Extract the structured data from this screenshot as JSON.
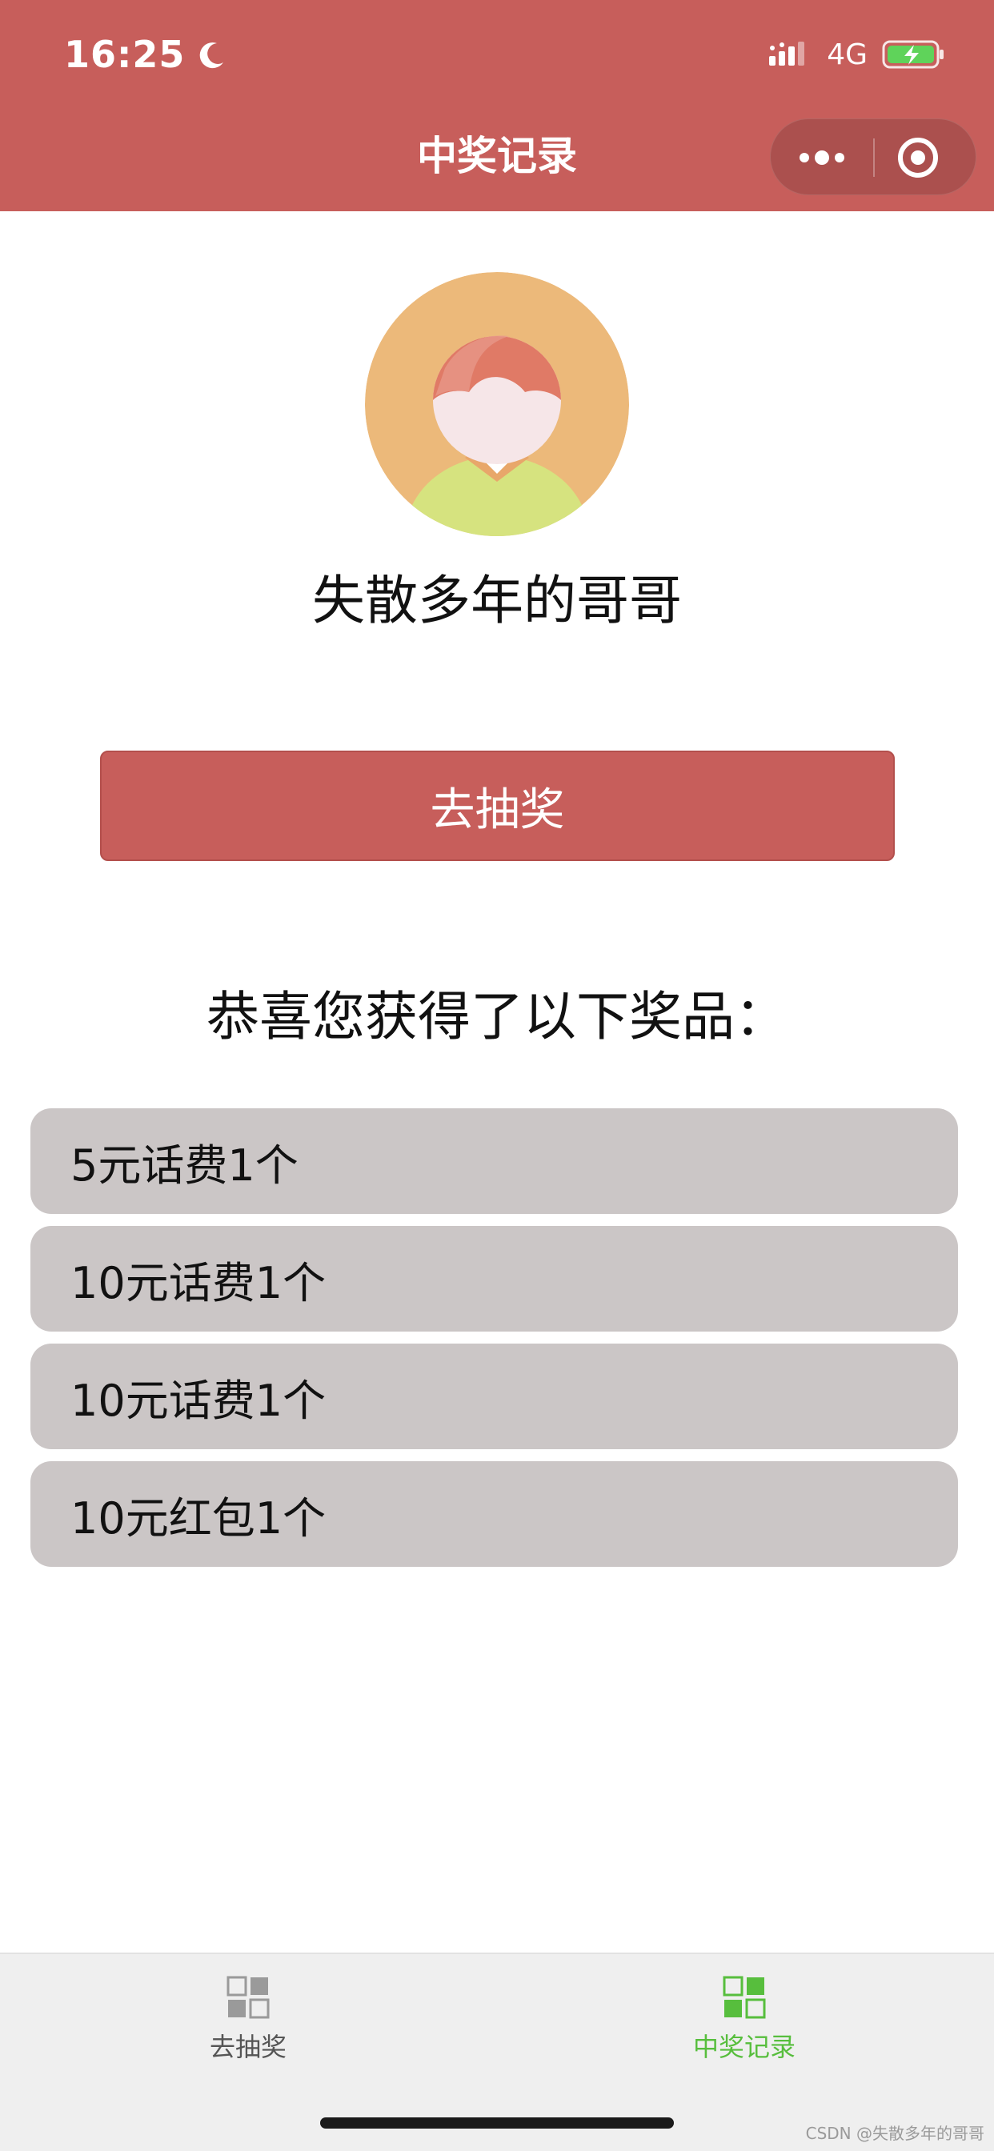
{
  "status_bar": {
    "time": "16:25",
    "network": "4G",
    "icons": [
      "moon-icon",
      "signal-icon",
      "battery-charging-icon"
    ]
  },
  "nav": {
    "title": "中奖记录",
    "capsule_icons": [
      "more-icon",
      "close-miniprogram-icon"
    ]
  },
  "profile": {
    "username": "失散多年的哥哥",
    "avatar_icon": "avatar-cartoon-icon"
  },
  "lottery_button": {
    "label": "去抽奖"
  },
  "congrats_text": "恭喜您获得了以下奖品：",
  "prizes": [
    {
      "text": "5元话费1个"
    },
    {
      "text": "10元话费1个"
    },
    {
      "text": "10元话费1个"
    },
    {
      "text": "10元红包1个"
    }
  ],
  "tabbar": {
    "tabs": [
      {
        "label": "去抽奖",
        "icon": "grid-icon",
        "active": false
      },
      {
        "label": "中奖记录",
        "icon": "grid-icon",
        "active": true
      }
    ]
  },
  "watermark": "CSDN @失散多年的哥哥",
  "colors": {
    "theme": "#c75e5b",
    "prize_bg": "#cbc6c6",
    "tab_active": "#57be3d",
    "tab_inactive": "#555555"
  }
}
